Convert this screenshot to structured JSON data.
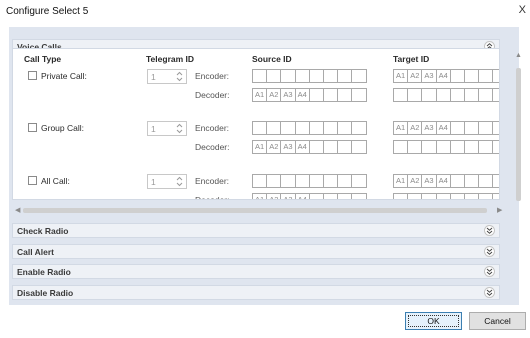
{
  "window": {
    "title": "Configure Select 5",
    "close_glyph": "X"
  },
  "sections": {
    "voice_calls": {
      "label": "Voice Calls",
      "state": "expanded"
    },
    "check_radio": {
      "label": "Check Radio",
      "state": "collapsed"
    },
    "call_alert": {
      "label": "Call Alert",
      "state": "collapsed"
    },
    "enable_radio": {
      "label": "Enable Radio",
      "state": "collapsed"
    },
    "disable_radio": {
      "label": "Disable Radio",
      "state": "collapsed"
    }
  },
  "voice_calls": {
    "headers": {
      "call_type": "Call Type",
      "telegram_id": "Telegram ID",
      "source_id": "Source ID",
      "target_id": "Target ID"
    },
    "encoder_label": "Encoder:",
    "decoder_label": "Decoder:",
    "rows": [
      {
        "label": "Private Call:",
        "checked": false,
        "telegram_id": "1"
      },
      {
        "label": "Group Call:",
        "checked": false,
        "telegram_id": "1"
      },
      {
        "label": "All Call:",
        "checked": false,
        "telegram_id": "1"
      }
    ],
    "placeholder_cells": [
      "A1",
      "A2",
      "A3",
      "A4"
    ]
  },
  "buttons": {
    "ok": "OK",
    "cancel": "Cancel"
  },
  "colors": {
    "panel": "#dfe5ef",
    "section_bar": "#eef1f6",
    "primary_border": "#3c7fb1"
  }
}
